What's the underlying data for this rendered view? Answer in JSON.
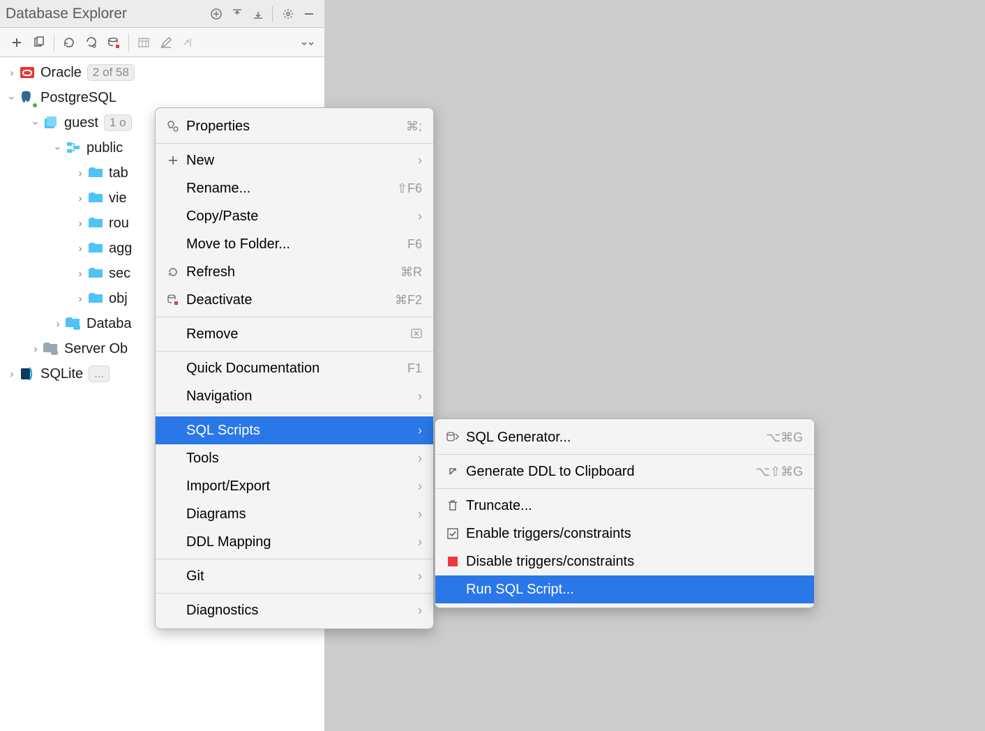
{
  "panel": {
    "title": "Database Explorer"
  },
  "tree": {
    "oracle": {
      "label": "Oracle",
      "badge": "2 of 58"
    },
    "postgres": {
      "label": "PostgreSQL"
    },
    "guest": {
      "label": "guest",
      "badge": "1 o"
    },
    "public": {
      "label": "public"
    },
    "tables": {
      "label": "tab"
    },
    "views": {
      "label": "vie"
    },
    "routines": {
      "label": "rou"
    },
    "aggregates": {
      "label": "agg"
    },
    "sequences": {
      "label": "sec"
    },
    "objects": {
      "label": "obj"
    },
    "database": {
      "label": "Databa"
    },
    "server": {
      "label": "Server Ob"
    },
    "sqlite": {
      "label": "SQLite",
      "badge": "..."
    }
  },
  "menu": {
    "properties": {
      "label": "Properties",
      "shortcut": "⌘;"
    },
    "new": {
      "label": "New"
    },
    "rename": {
      "label": "Rename...",
      "shortcut": "⇧F6"
    },
    "copy": {
      "label": "Copy/Paste"
    },
    "move": {
      "label": "Move to Folder...",
      "shortcut": "F6"
    },
    "refresh": {
      "label": "Refresh",
      "shortcut": "⌘R"
    },
    "deactivate": {
      "label": "Deactivate",
      "shortcut": "⌘F2"
    },
    "remove": {
      "label": "Remove"
    },
    "quickdoc": {
      "label": "Quick Documentation",
      "shortcut": "F1"
    },
    "navigation": {
      "label": "Navigation"
    },
    "sqlscripts": {
      "label": "SQL Scripts"
    },
    "tools": {
      "label": "Tools"
    },
    "import": {
      "label": "Import/Export"
    },
    "diagrams": {
      "label": "Diagrams"
    },
    "ddlmapping": {
      "label": "DDL Mapping"
    },
    "git": {
      "label": "Git"
    },
    "diagnostics": {
      "label": "Diagnostics"
    }
  },
  "submenu": {
    "sqlgen": {
      "label": "SQL Generator...",
      "shortcut": "⌥⌘G"
    },
    "genddl": {
      "label": "Generate DDL to Clipboard",
      "shortcut": "⌥⇧⌘G"
    },
    "truncate": {
      "label": "Truncate..."
    },
    "enable": {
      "label": "Enable triggers/constraints"
    },
    "disable": {
      "label": "Disable triggers/constraints"
    },
    "runsql": {
      "label": "Run SQL Script..."
    }
  }
}
